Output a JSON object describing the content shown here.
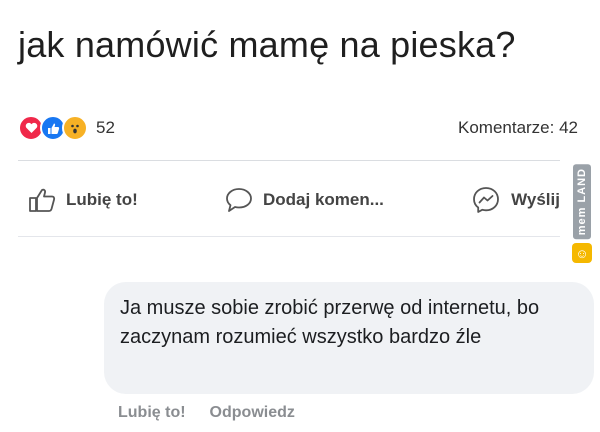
{
  "post": {
    "text": "jak namówić mamę na pieska?"
  },
  "stats": {
    "reactions": [
      "love",
      "like",
      "wow"
    ],
    "reaction_count": "52",
    "comments": "Komentarze: 42"
  },
  "actions": {
    "like": "Lubię to!",
    "comment": "Dodaj komen...",
    "share": "Wyślij"
  },
  "watermark": {
    "text": "mem LAND",
    "icon": "smiley-icon"
  },
  "comment": {
    "text": "Ja musze sobie zrobić przerwę od internetu, bo zaczynam rozumieć wszystko bardzo źle",
    "like": "Lubię to!",
    "reply": "Odpowiedz"
  },
  "colors": {
    "love": "#f0284a",
    "like": "#1877f2",
    "wow": "#f7b125",
    "bubble": "#f0f2f5"
  }
}
